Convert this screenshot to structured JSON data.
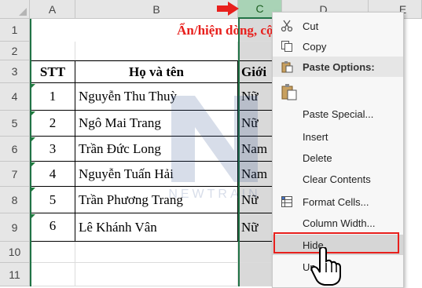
{
  "columns": [
    "A",
    "B",
    "C",
    "D",
    "E"
  ],
  "rows": [
    "1",
    "2",
    "3",
    "4",
    "5",
    "6",
    "7",
    "8",
    "9",
    "10",
    "11"
  ],
  "title": "Ẩn/hiện dòng, cột trong Ex",
  "headers": {
    "stt": "STT",
    "name": "Họ và tên",
    "gender": "Giới"
  },
  "people": [
    {
      "stt": "1",
      "name": "Nguyễn Thu Thuỳ",
      "gender": "Nữ"
    },
    {
      "stt": "2",
      "name": "Ngô Mai Trang",
      "gender": "Nữ"
    },
    {
      "stt": "3",
      "name": "Trần Đức Long",
      "gender": "Nam"
    },
    {
      "stt": "4",
      "name": "Nguyễn Tuấn Hải",
      "gender": "Nam"
    },
    {
      "stt": "5",
      "name": "Trần Phương Trang",
      "gender": "Nữ"
    },
    {
      "stt": "6",
      "name": "Lê Khánh Vân",
      "gender": "Nữ"
    }
  ],
  "watermark": "NEWTRAIN",
  "menu": {
    "cut": "Cut",
    "copy": "Copy",
    "paste_options": "Paste Options:",
    "paste_special": "Paste Special...",
    "insert": "Insert",
    "delete": "Delete",
    "clear_contents": "Clear Contents",
    "format_cells": "Format Cells...",
    "column_width": "Column Width...",
    "hide": "Hide",
    "unhide": "Un"
  },
  "colors": {
    "accent_green": "#217346",
    "title_red": "#e8201d",
    "highlight_red": "#e8201d"
  }
}
